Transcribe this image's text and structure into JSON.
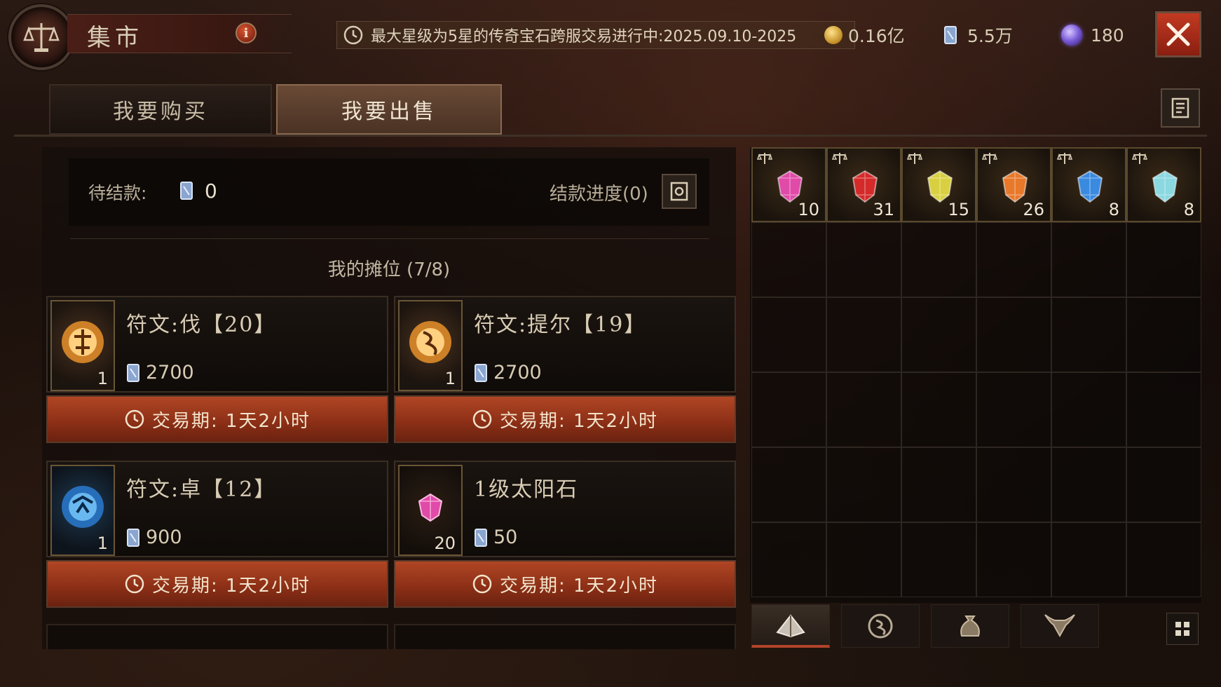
{
  "header": {
    "title": "集市",
    "info_label": "i",
    "ticker": "最大星级为5星的传奇宝石跨服交易进行中:2025.09.10-2025",
    "currencies": [
      {
        "icon": "gold-coin-icon",
        "value": "0.16亿"
      },
      {
        "icon": "crystal-icon",
        "value": "5.5万"
      },
      {
        "icon": "orb-icon",
        "value": "180"
      }
    ]
  },
  "tabs": [
    {
      "label": "我要购买",
      "active": false
    },
    {
      "label": "我要出售",
      "active": true
    }
  ],
  "pending": {
    "label": "待结款:",
    "value": "0",
    "progress_label": "结款进度(0)"
  },
  "stall": {
    "title": "我的摊位 (7/8)",
    "listings": [
      {
        "name": "符文:伐【20】",
        "qty": "1",
        "price": "2700",
        "period": "交易期:  1天2小时",
        "icon": "rune-fire-icon"
      },
      {
        "name": "符文:提尔【19】",
        "qty": "1",
        "price": "2700",
        "period": "交易期:  1天2小时",
        "icon": "rune-fire-icon"
      },
      {
        "name": "符文:卓【12】",
        "qty": "1",
        "price": "900",
        "period": "交易期:  1天2小时",
        "icon": "rune-ice-icon"
      },
      {
        "name": "1级太阳石",
        "qty": "20",
        "price": "50",
        "period": "交易期:  1天2小时",
        "icon": "pink-gem-icon"
      }
    ]
  },
  "inventory": {
    "items": [
      {
        "count": "10",
        "color": "#e04aa8",
        "icon": "pink-gem-icon"
      },
      {
        "count": "31",
        "color": "#d42a2a",
        "icon": "red-gem-icon"
      },
      {
        "count": "15",
        "color": "#d8d040",
        "icon": "yellow-gem-icon"
      },
      {
        "count": "26",
        "color": "#e8782a",
        "icon": "orange-gem-icon"
      },
      {
        "count": "8",
        "color": "#3a8ae0",
        "icon": "blue-gem-icon"
      },
      {
        "count": "8",
        "color": "#8ad8e0",
        "icon": "cyan-gem-icon"
      }
    ],
    "bottom_tabs": [
      "gem-category-icon",
      "rune-category-icon",
      "pouch-category-icon",
      "demon-category-icon"
    ]
  }
}
